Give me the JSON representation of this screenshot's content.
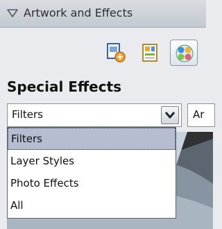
{
  "panel": {
    "title": "Artwork and Effects"
  },
  "toolbar": {
    "buttons": [
      {
        "icon": "artwork-icon",
        "active": false
      },
      {
        "icon": "themes-icon",
        "active": false
      },
      {
        "icon": "effects-icon",
        "active": true
      }
    ]
  },
  "section": {
    "title": "Special Effects"
  },
  "filter_select": {
    "selected": "Filters",
    "options": [
      "Filters",
      "Layer Styles",
      "Photo Effects",
      "All"
    ]
  },
  "second_select": {
    "value": "Ar"
  }
}
